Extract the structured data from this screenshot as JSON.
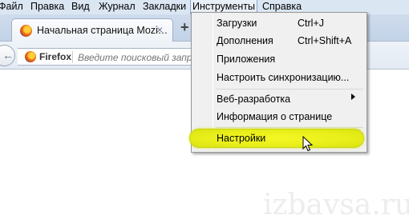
{
  "menubar": {
    "items": [
      {
        "label": "Файл"
      },
      {
        "label": "Правка"
      },
      {
        "label": "Вид"
      },
      {
        "label": "Журнал"
      },
      {
        "label": "Закладки"
      },
      {
        "label": "Инструменты"
      },
      {
        "label": "Справка"
      }
    ]
  },
  "tab": {
    "title": "Начальная страница Mozi…",
    "close_glyph": "×",
    "new_tab_glyph": "+"
  },
  "navbar": {
    "back_glyph": "←",
    "identity_label": "Firefox",
    "search_placeholder": "Введите поисковый запр"
  },
  "dropdown": {
    "items": [
      {
        "label": "Загрузки",
        "shortcut": "Ctrl+J"
      },
      {
        "label": "Дополнения",
        "shortcut": "Ctrl+Shift+A"
      },
      {
        "label": "Приложения"
      },
      {
        "label": "Настроить синхронизацию..."
      },
      {
        "label": "Веб-разработка"
      },
      {
        "label": "Информация о странице"
      },
      {
        "label": "Настройки"
      }
    ],
    "highlight_color": "#eef01e"
  },
  "watermark": "izbavsa.ru"
}
